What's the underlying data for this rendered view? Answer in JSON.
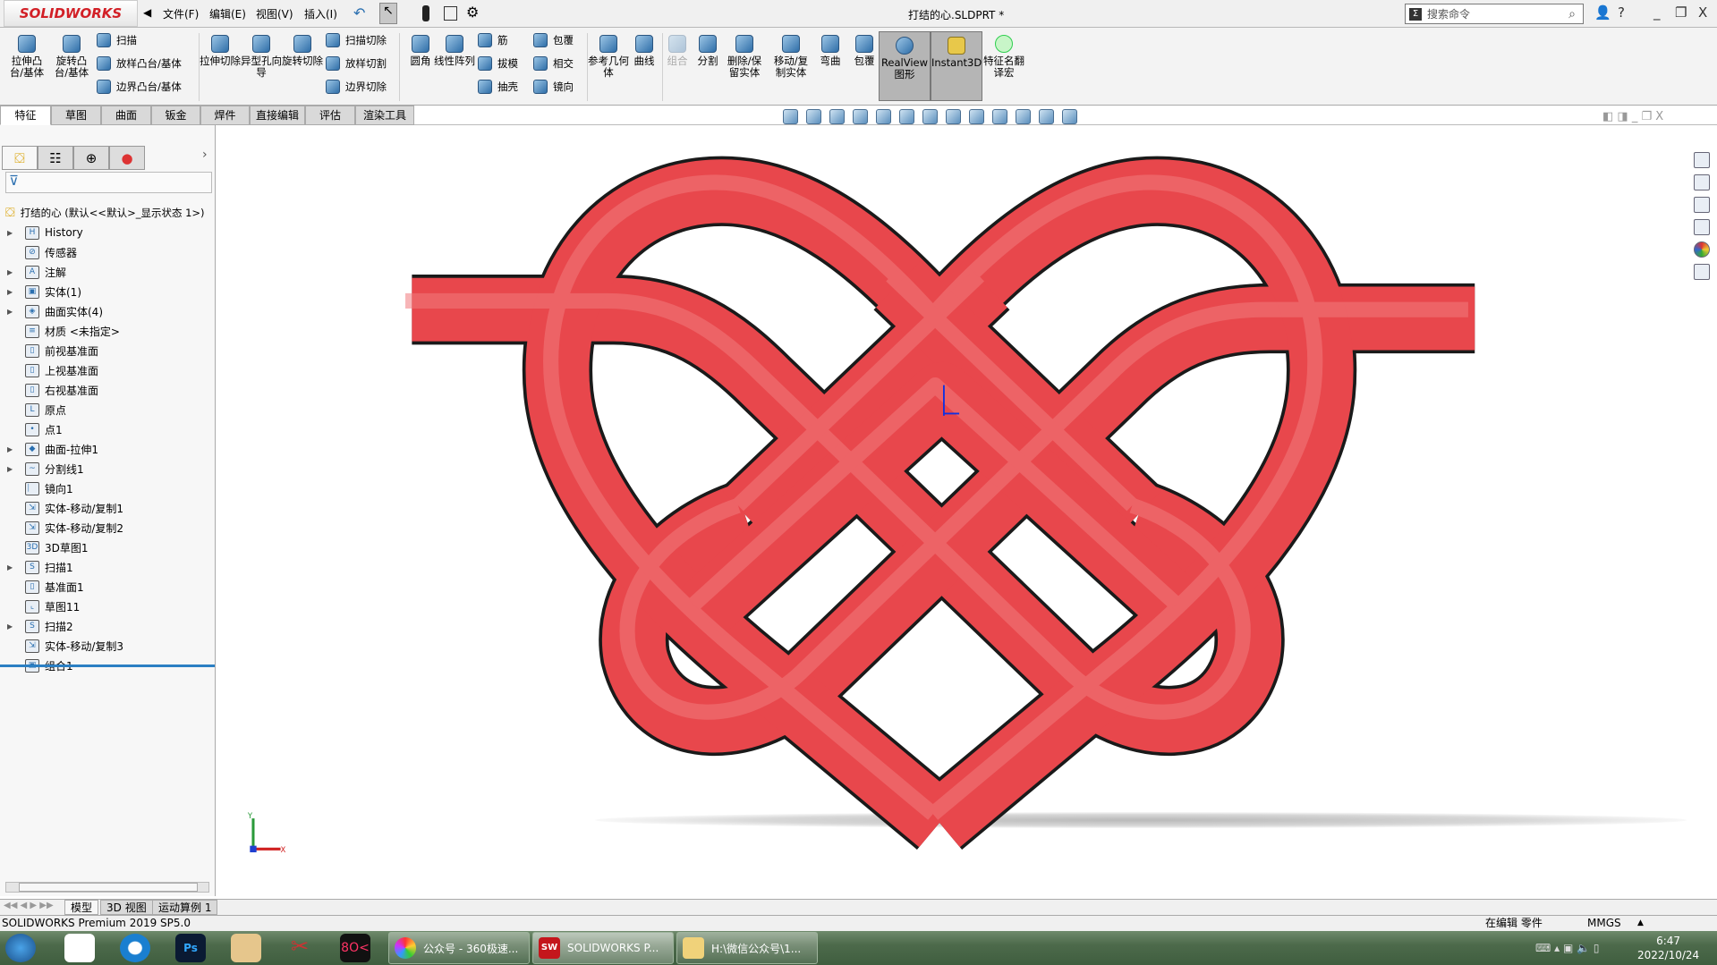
{
  "app": {
    "logo": "SOLIDWORKS",
    "title": "打结的心.SLDPRT *",
    "search_placeholder": "搜索命令",
    "brand_color": "#d21f26",
    "model_color": "#e8474c"
  },
  "menu": [
    "文件(F)",
    "编辑(E)",
    "视图(V)",
    "插入(I)"
  ],
  "ribbon": {
    "large": [
      {
        "label": "拉伸凸台/基体",
        "icon": "extrude-boss-icon"
      },
      {
        "label": "旋转凸台/基体",
        "icon": "revolve-boss-icon"
      },
      {
        "label": "拉伸切除",
        "icon": "extrude-cut-icon"
      },
      {
        "label": "异型孔向导",
        "icon": "hole-wizard-icon"
      },
      {
        "label": "旋转切除",
        "icon": "revolve-cut-icon"
      },
      {
        "label": "圆角",
        "icon": "fillet-icon"
      },
      {
        "label": "线性阵列",
        "icon": "linear-pattern-icon"
      },
      {
        "label": "参考几何体",
        "icon": "reference-geometry-icon"
      },
      {
        "label": "曲线",
        "icon": "curve-icon"
      },
      {
        "label": "组合",
        "icon": "combine-icon",
        "disabled": true
      },
      {
        "label": "分割",
        "icon": "split-icon"
      },
      {
        "label": "删除/保留实体",
        "icon": "delete-body-icon"
      },
      {
        "label": "移动/复制实体",
        "icon": "move-copy-icon"
      },
      {
        "label": "弯曲",
        "icon": "flex-icon"
      },
      {
        "label": "包覆",
        "icon": "wrap-icon"
      },
      {
        "label": "RealView 图形",
        "icon": "realview-icon",
        "pressed": true
      },
      {
        "label": "Instant3D",
        "icon": "instant3d-icon",
        "pressed": true
      },
      {
        "label": "特征名翻译宏",
        "icon": "macro-icon"
      }
    ],
    "small": [
      {
        "label": "扫描",
        "icon": "sweep-icon"
      },
      {
        "label": "放样凸台/基体",
        "icon": "loft-icon"
      },
      {
        "label": "边界凸台/基体",
        "icon": "boundary-boss-icon"
      },
      {
        "label": "扫描切除",
        "icon": "swept-cut-icon"
      },
      {
        "label": "放样切割",
        "icon": "lofted-cut-icon"
      },
      {
        "label": "边界切除",
        "icon": "boundary-cut-icon"
      },
      {
        "label": "筋",
        "icon": "rib-icon"
      },
      {
        "label": "拔模",
        "icon": "draft-icon"
      },
      {
        "label": "抽壳",
        "icon": "shell-icon"
      },
      {
        "label": "包覆",
        "icon": "wrap-icon"
      },
      {
        "label": "相交",
        "icon": "intersect-icon"
      },
      {
        "label": "镜向",
        "icon": "mirror-icon"
      }
    ]
  },
  "tabs": [
    "特征",
    "草图",
    "曲面",
    "钣金",
    "焊件",
    "直接编辑",
    "评估",
    "渲染工具"
  ],
  "tree": {
    "root": "打结的心  (默认<<默认>_显示状态 1>)",
    "items": [
      {
        "label": "History",
        "expand": true,
        "icon": "H"
      },
      {
        "label": "传感器",
        "expand": false,
        "icon": "⊘"
      },
      {
        "label": "注解",
        "expand": true,
        "icon": "A"
      },
      {
        "label": "实体(1)",
        "expand": true,
        "icon": "▣"
      },
      {
        "label": "曲面实体(4)",
        "expand": true,
        "icon": "◈"
      },
      {
        "label": "材质 <未指定>",
        "expand": false,
        "icon": "≡"
      },
      {
        "label": "前视基准面",
        "expand": false,
        "icon": "▯"
      },
      {
        "label": "上视基准面",
        "expand": false,
        "icon": "▯"
      },
      {
        "label": "右视基准面",
        "expand": false,
        "icon": "▯"
      },
      {
        "label": "原点",
        "expand": false,
        "icon": "L"
      },
      {
        "label": "点1",
        "expand": false,
        "icon": "•"
      },
      {
        "label": "曲面-拉伸1",
        "expand": true,
        "icon": "◆"
      },
      {
        "label": "分割线1",
        "expand": true,
        "icon": "~"
      },
      {
        "label": "镜向1",
        "expand": false,
        "icon": "⎸"
      },
      {
        "label": "实体-移动/复制1",
        "expand": false,
        "icon": "⇲"
      },
      {
        "label": "实体-移动/复制2",
        "expand": false,
        "icon": "⇲"
      },
      {
        "label": "3D草图1",
        "expand": false,
        "icon": "3D"
      },
      {
        "label": "扫描1",
        "expand": true,
        "icon": "S"
      },
      {
        "label": "基准面1",
        "expand": false,
        "icon": "▯"
      },
      {
        "label": "草图11",
        "expand": false,
        "icon": "⌞"
      },
      {
        "label": "扫描2",
        "expand": true,
        "icon": "S"
      },
      {
        "label": "实体-移动/复制3",
        "expand": false,
        "icon": "⇲"
      },
      {
        "label": "组合1",
        "expand": false,
        "icon": "▣"
      }
    ]
  },
  "bottom_tabs": [
    "模型",
    "3D 视图",
    "运动算例 1"
  ],
  "status": {
    "version": "SOLIDWORKS Premium 2019 SP5.0",
    "mode": "在编辑 零件",
    "units": "MMGS"
  },
  "taskbar": {
    "windows": [
      "公众号 - 360极速...",
      "SOLIDWORKS P...",
      "H:\\微信公众号\\1..."
    ],
    "time": "6:47",
    "date": "2022/10/24"
  },
  "triad": {
    "x": "X",
    "y": "Y"
  }
}
